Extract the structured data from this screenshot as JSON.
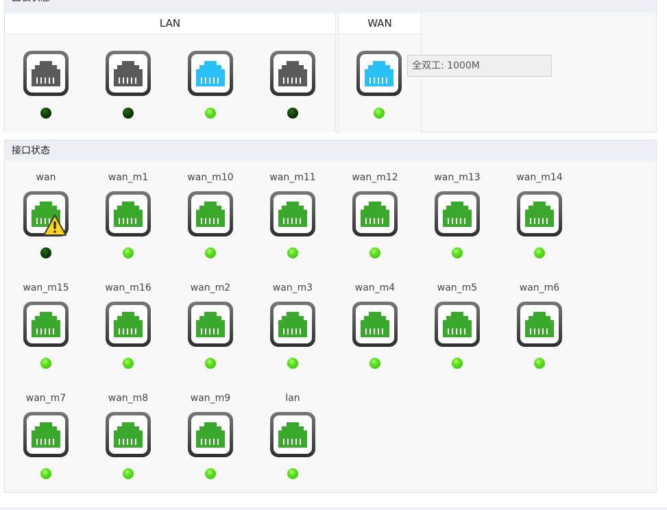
{
  "panel_status": {
    "title": "面板状态",
    "groups": [
      {
        "title": "LAN"
      },
      {
        "title": "WAN"
      }
    ],
    "lan_ports": [
      {
        "color": "gray",
        "link": false
      },
      {
        "color": "gray",
        "link": false
      },
      {
        "color": "blue",
        "link": true
      },
      {
        "color": "gray",
        "link": false
      }
    ],
    "wan_ports": [
      {
        "color": "blue",
        "link": true
      }
    ],
    "tooltip": "全双工: 1000M"
  },
  "interface_status": {
    "title": "接口状态",
    "interfaces": [
      {
        "name": "wan",
        "link": false,
        "warning": true
      },
      {
        "name": "wan_m1",
        "link": true
      },
      {
        "name": "wan_m10",
        "link": true
      },
      {
        "name": "wan_m11",
        "link": true
      },
      {
        "name": "wan_m12",
        "link": true
      },
      {
        "name": "wan_m13",
        "link": true
      },
      {
        "name": "wan_m14",
        "link": true
      },
      {
        "name": "wan_m15",
        "link": true
      },
      {
        "name": "wan_m16",
        "link": true
      },
      {
        "name": "wan_m2",
        "link": true
      },
      {
        "name": "wan_m3",
        "link": true
      },
      {
        "name": "wan_m4",
        "link": true
      },
      {
        "name": "wan_m5",
        "link": true
      },
      {
        "name": "wan_m6",
        "link": true
      },
      {
        "name": "wan_m7",
        "link": true
      },
      {
        "name": "wan_m8",
        "link": true
      },
      {
        "name": "wan_m9",
        "link": true
      },
      {
        "name": "lan",
        "link": true
      }
    ]
  },
  "colors": {
    "port_gray": "#5a5a5a",
    "port_blue": "#29c1f5",
    "port_green": "#3aa82a",
    "led_on": "#5ee022",
    "led_off": "#0c3a06"
  },
  "icons": {
    "port": "ethernet-port-icon",
    "warning": "warning-triangle-icon"
  }
}
